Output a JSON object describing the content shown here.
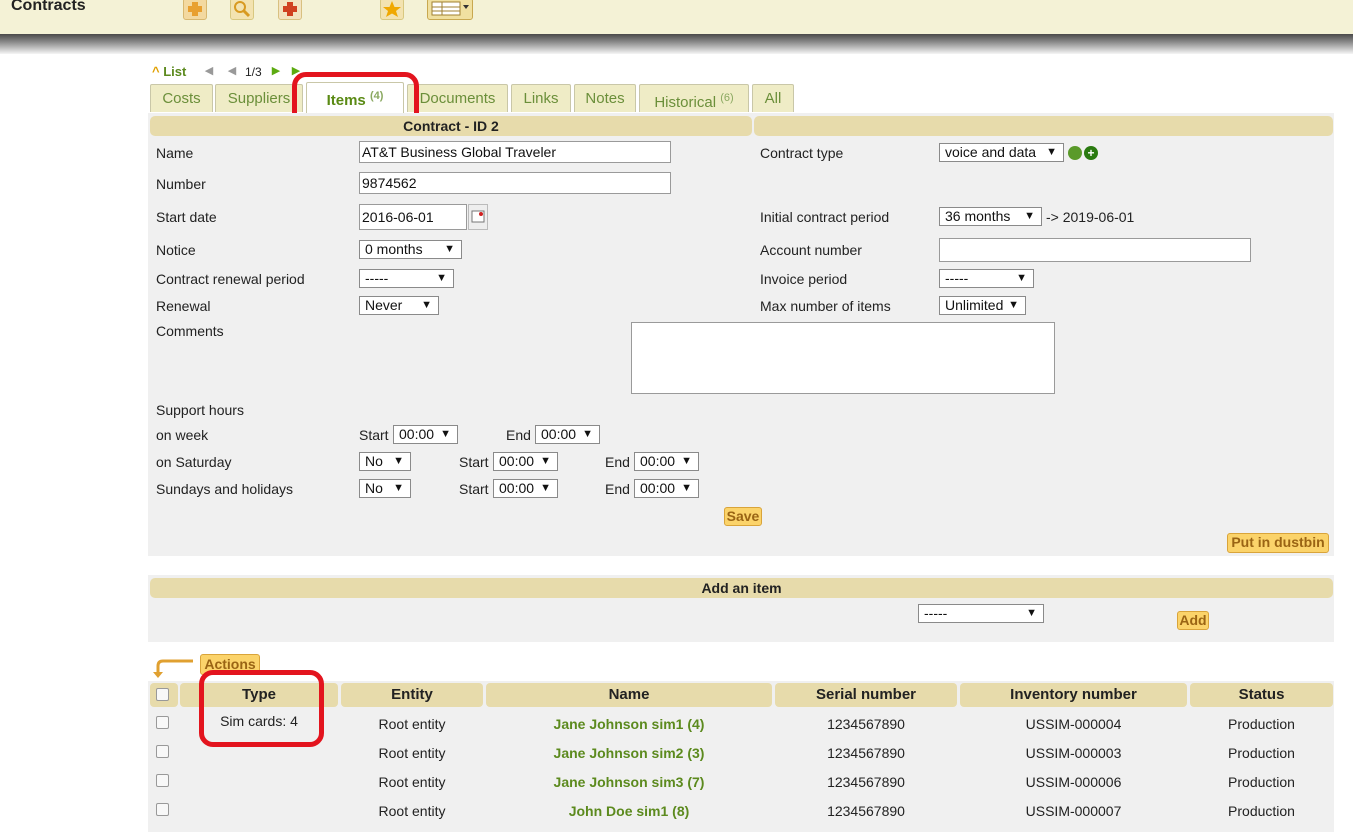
{
  "app": {
    "title": "Contracts"
  },
  "nav": {
    "list_label": "List",
    "position": "1/3"
  },
  "tabs": [
    {
      "label": "Costs",
      "count": ""
    },
    {
      "label": "Suppliers",
      "count": ""
    },
    {
      "label": "Items",
      "count": "(4)"
    },
    {
      "label": "Documents",
      "count": ""
    },
    {
      "label": "Links",
      "count": ""
    },
    {
      "label": "Notes",
      "count": ""
    },
    {
      "label": "Historical",
      "count": "(6)"
    },
    {
      "label": "All",
      "count": ""
    }
  ],
  "form": {
    "header": "Contract - ID 2",
    "name_label": "Name",
    "name_value": "AT&T Business Global Traveler",
    "number_label": "Number",
    "number_value": "9874562",
    "start_date_label": "Start date",
    "start_date_value": "2016-06-01",
    "notice_label": "Notice",
    "notice_value": "0 months",
    "renewal_period_label": "Contract renewal period",
    "renewal_period_value": "-----",
    "renewal_label": "Renewal",
    "renewal_value": "Never",
    "comments_label": "Comments",
    "comments_value": "",
    "contract_type_label": "Contract type",
    "contract_type_value": "voice and data",
    "initial_period_label": "Initial contract period",
    "initial_period_value": "36 months",
    "initial_period_end": "-> 2019-06-01",
    "account_number_label": "Account number",
    "account_number_value": "",
    "invoice_period_label": "Invoice period",
    "invoice_period_value": "-----",
    "max_items_label": "Max number of items",
    "max_items_value": "Unlimited",
    "support_hours_label": "Support hours",
    "on_week_label": "on week",
    "on_saturday_label": "on Saturday",
    "sundays_label": "Sundays and holidays",
    "start_label": "Start",
    "end_label": "End",
    "week_start": "00:00",
    "week_end": "00:00",
    "saturday_enabled": "No",
    "saturday_start": "00:00",
    "saturday_end": "00:00",
    "sunday_enabled": "No",
    "sunday_start": "00:00",
    "sunday_end": "00:00",
    "save_label": "Save",
    "dustbin_label": "Put in dustbin"
  },
  "add_item": {
    "header": "Add an item",
    "select_value": "-----",
    "add_label": "Add"
  },
  "items_table": {
    "actions_label": "Actions",
    "columns": [
      "Type",
      "Entity",
      "Name",
      "Serial number",
      "Inventory number",
      "Status"
    ],
    "type_group": "Sim cards: 4",
    "rows": [
      {
        "entity": "Root entity",
        "name": "Jane Johnson sim1 (4)",
        "serial": "1234567890",
        "inventory": "USSIM-000004",
        "status": "Production"
      },
      {
        "entity": "Root entity",
        "name": "Jane Johnson sim2 (3)",
        "serial": "1234567890",
        "inventory": "USSIM-000003",
        "status": "Production"
      },
      {
        "entity": "Root entity",
        "name": "Jane Johnson sim3 (7)",
        "serial": "1234567890",
        "inventory": "USSIM-000006",
        "status": "Production"
      },
      {
        "entity": "Root entity",
        "name": "John Doe sim1 (8)",
        "serial": "1234567890",
        "inventory": "USSIM-000007",
        "status": "Production"
      }
    ]
  }
}
